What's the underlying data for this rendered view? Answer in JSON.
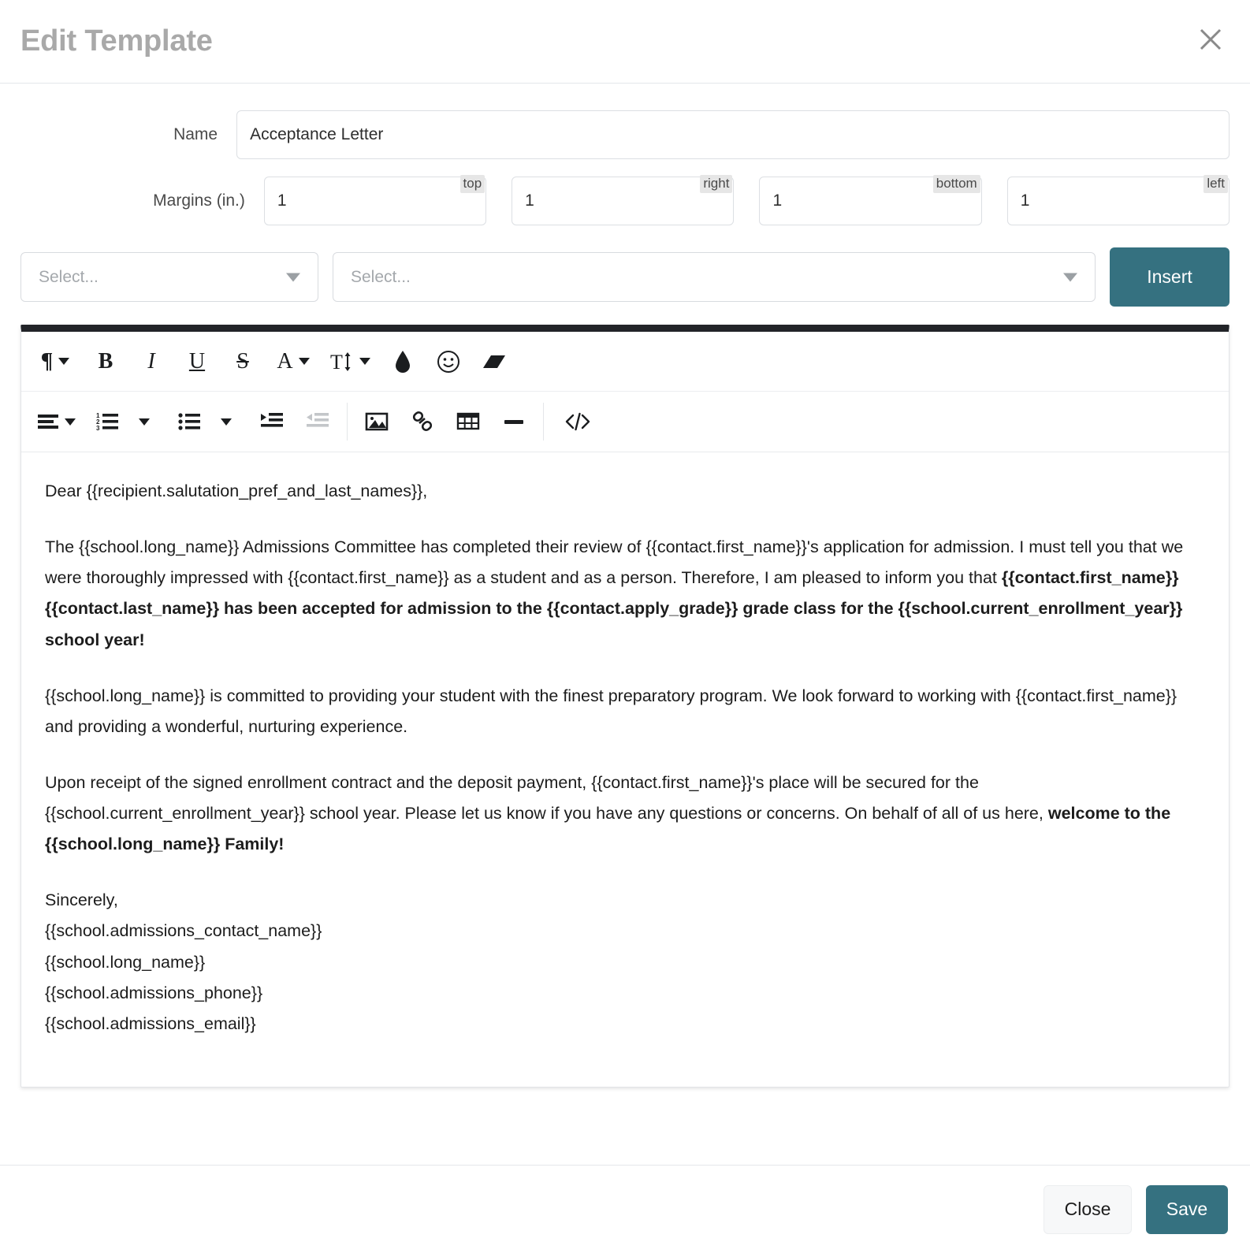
{
  "dialog": {
    "title": "Edit Template",
    "close_icon": "close-icon"
  },
  "form": {
    "name_label": "Name",
    "name_value": "Acceptance Letter",
    "margins_label": "Margins (in.)",
    "margins": [
      {
        "badge": "top",
        "value": "1"
      },
      {
        "badge": "right",
        "value": "1"
      },
      {
        "badge": "bottom",
        "value": "1"
      },
      {
        "badge": "left",
        "value": "1"
      }
    ]
  },
  "merge_bar": {
    "select_1_placeholder": "Select...",
    "select_2_placeholder": "Select...",
    "insert_label": "Insert"
  },
  "editor": {
    "toolbar_row_1": [
      {
        "name": "paragraph-format-icon",
        "glyph": "¶",
        "caret": true,
        "style": "pilcrow"
      },
      {
        "name": "bold-icon",
        "glyph": "B",
        "caret": false,
        "style": "bold"
      },
      {
        "name": "italic-icon",
        "glyph": "I",
        "caret": false,
        "style": "italic"
      },
      {
        "name": "underline-icon",
        "glyph": "U",
        "caret": false,
        "style": "under"
      },
      {
        "name": "strikethrough-icon",
        "glyph": "S",
        "caret": false,
        "style": "strike"
      },
      {
        "name": "font-color-icon",
        "glyph": "A",
        "caret": true,
        "style": ""
      },
      {
        "name": "font-size-icon",
        "glyph": "T↕",
        "caret": true,
        "style": ""
      },
      {
        "name": "highlight-color-icon",
        "glyph": "◆",
        "caret": false,
        "style": ""
      },
      {
        "name": "emoticon-icon",
        "glyph": "☺",
        "caret": false,
        "style": ""
      },
      {
        "name": "clear-formatting-icon",
        "glyph": "▱",
        "caret": false,
        "style": ""
      }
    ],
    "toolbar_row_2": [
      {
        "name": "align-icon",
        "caret": true,
        "disabled": false
      },
      {
        "name": "ordered-list-icon",
        "caret": true,
        "disabled": false
      },
      {
        "name": "unordered-list-icon",
        "caret": true,
        "disabled": false
      },
      {
        "name": "increase-indent-icon",
        "caret": false,
        "disabled": false
      },
      {
        "name": "decrease-indent-icon",
        "caret": false,
        "disabled": true
      },
      {
        "name": "insert-image-icon",
        "caret": false,
        "disabled": false
      },
      {
        "name": "insert-link-icon",
        "caret": false,
        "disabled": false
      },
      {
        "name": "insert-table-icon",
        "caret": false,
        "disabled": false
      },
      {
        "name": "horizontal-rule-icon",
        "caret": false,
        "disabled": false
      },
      {
        "name": "code-view-icon",
        "caret": false,
        "disabled": false
      }
    ],
    "document": {
      "salutation": "Dear {{recipient.salutation_pref_and_last_names}},",
      "paragraph_2_plain": "The {{school.long_name}} Admissions Committee has completed their review of {{contact.first_name}}'s application for admission. I must tell you that we were thoroughly impressed with {{contact.first_name}} as a student and as a person. Therefore, I am pleased to inform you that ",
      "paragraph_2_bold": "{{contact.first_name}} {{contact.last_name}} has been accepted for admission to the {{contact.apply_grade}} grade class for the {{school.current_enrollment_year}} school year!",
      "paragraph_3": "{{school.long_name}} is committed to providing your student with the finest preparatory program. We look forward to working with {{contact.first_name}} and providing a wonderful, nurturing experience.",
      "paragraph_4_plain": "Upon receipt of the signed enrollment contract and the deposit payment, {{contact.first_name}}'s place will be secured for the {{school.current_enrollment_year}} school year. Please let us know if you have any questions or concerns. On behalf of all of us here, ",
      "paragraph_4_bold": "welcome to the {{school.long_name}} Family!",
      "signature_lines": [
        "Sincerely,",
        "{{school.admissions_contact_name}}",
        "{{school.long_name}}",
        "{{school.admissions_phone}}",
        "{{school.admissions_email}}"
      ]
    }
  },
  "footer": {
    "close_label": "Close",
    "save_label": "Save"
  },
  "colors": {
    "accent_teal": "#357180",
    "toolbar_bar": "#222428",
    "title_gray": "#a9a9a9",
    "badge_gray": "#e6e6e6"
  }
}
